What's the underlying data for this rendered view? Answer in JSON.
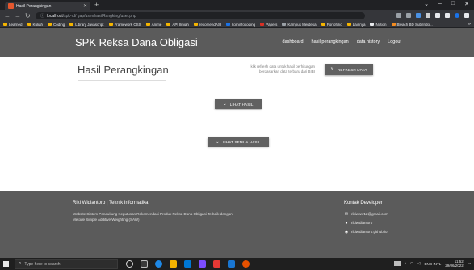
{
  "browser": {
    "tab_title": "Hasil Perangkingan",
    "new_tab": "+",
    "url_host": "localhost",
    "url_path": "/spk-rd/ gap/user/hasilRangking/user.php",
    "window_controls": [
      "⌄",
      "–",
      "□",
      "✕"
    ],
    "bookmarks": [
      "Learned",
      "Kuliah",
      "Coding",
      "Library Javascript",
      "Framework CSS",
      "Animé",
      "API Ilmiah",
      "rekomendASI",
      "kominfokoding",
      "Papers",
      "Kampus Merdeka",
      "Portofolio",
      "Lainnya",
      "Notion",
      "Bleach BD Sub Indo..."
    ]
  },
  "site": {
    "brand": "SPK Reksa Dana Obligasi",
    "nav": [
      "dashboard",
      "hasil perangkingan",
      "data history",
      "Logout"
    ]
  },
  "main": {
    "title": "Hasil Perangkingan",
    "refresh_note": "klik refresh data untuk hasil perhitungan berdasarkan data terbaru dari BIBI",
    "refresh_button": "REFRESH DATA",
    "lihat_hasil_button": "LIHAT HASIL",
    "lihat_semua_button": "LIHAT SEMUA HASIL"
  },
  "footer": {
    "name": "Riki Widiantoro | Teknik Informatika",
    "description": "Website Sistem Pendukung Keputusan Rekomendasi Produk Reksa Dana Obligasi Terbaik dengan Metode Simple Additive Weighting (SAW)",
    "contact_title": "Kontak Developer",
    "email": "rikiwww12@gmail.com",
    "github": "rikiwidiantoro",
    "website": "rikiwidiantoro.github.io"
  },
  "taskbar": {
    "search_placeholder": "Type here to search",
    "lang": "ENG INTL",
    "time": "11:52",
    "date": "29/06/2022"
  },
  "colors": {
    "header": "#5b5b5b",
    "button": "#616161",
    "browser_dark": "#202124"
  }
}
